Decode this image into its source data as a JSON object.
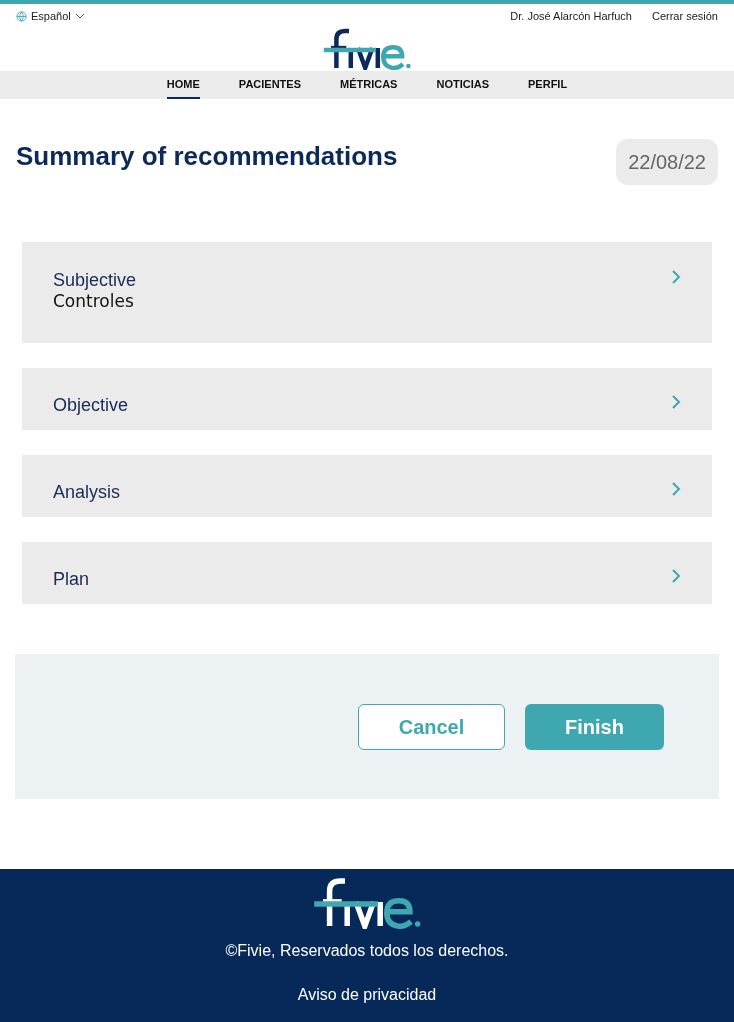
{
  "header": {
    "language": "Español",
    "user": "Dr. José Alarcón Harfuch",
    "logout": "Cerrar sesión"
  },
  "nav": [
    {
      "label": "HOME",
      "selected": true
    },
    {
      "label": "PACIENTES",
      "selected": false
    },
    {
      "label": "MÉTRICAS",
      "selected": false
    },
    {
      "label": "NOTICIAS",
      "selected": false
    },
    {
      "label": "PERFIL",
      "selected": false
    }
  ],
  "title": "Summary of recommendations",
  "date": "22/08/22",
  "sections": [
    {
      "title": "Subjective",
      "subtitle": "Controles"
    },
    {
      "title": "Objective"
    },
    {
      "title": "Analysis"
    },
    {
      "title": "Plan"
    }
  ],
  "buttons": {
    "cancel": "Cancel",
    "finish": "Finish"
  },
  "footer": {
    "copyright": "©Fivie, Reservados todos los derechos.",
    "privacy": "Aviso de privacidad"
  }
}
